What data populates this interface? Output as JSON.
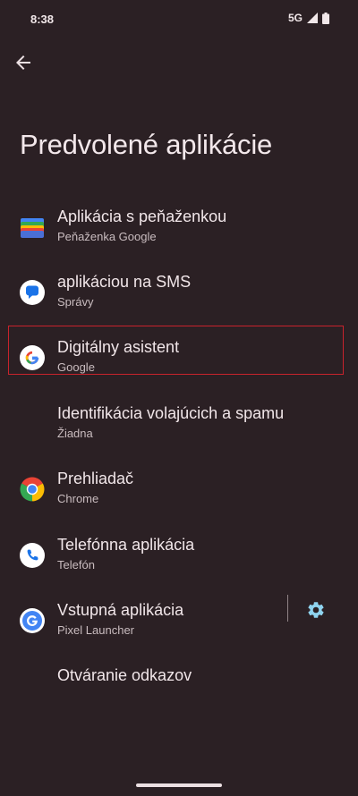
{
  "status": {
    "time": "8:38",
    "network": "5G"
  },
  "page": {
    "title": "Predvolené aplikácie"
  },
  "items": [
    {
      "label": "Aplikácia s peňaženkou",
      "sub": "Peňaženka Google"
    },
    {
      "label": "aplikáciou na SMS",
      "sub": "Správy"
    },
    {
      "label": "Digitálny asistent",
      "sub": "Google"
    },
    {
      "label": "Identifikácia volajúcich a spamu",
      "sub": "Žiadna"
    },
    {
      "label": "Prehliadač",
      "sub": "Chrome"
    },
    {
      "label": "Telefónna aplikácia",
      "sub": "Telefón"
    },
    {
      "label": "Vstupná aplikácia",
      "sub": "Pixel Launcher"
    },
    {
      "label": "Otváranie odkazov"
    }
  ],
  "icons": {
    "back": "arrow-back-icon",
    "wallet": "google-wallet-icon",
    "sms": "messages-icon",
    "assistant": "google-icon",
    "browser": "chrome-icon",
    "phone": "phone-icon",
    "launcher": "pixel-launcher-icon",
    "settings": "gear-icon"
  },
  "colors": {
    "background": "#2b2024",
    "highlight": "#c8232c",
    "accent": "#8fd3ef"
  }
}
